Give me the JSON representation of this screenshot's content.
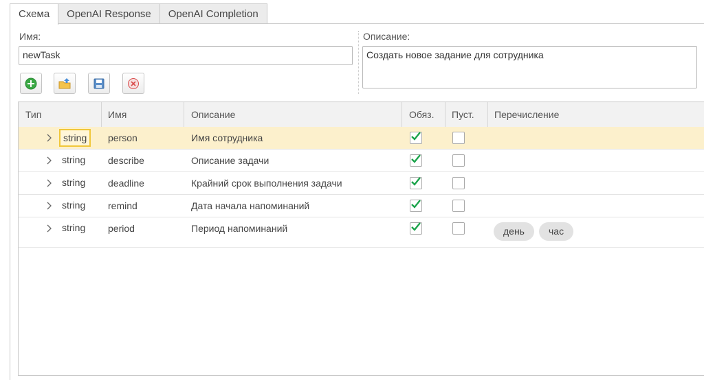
{
  "tabs": [
    "Схема",
    "OpenAI Response",
    "OpenAI Completion"
  ],
  "form": {
    "name_label": "Имя:",
    "name_value": "newTask",
    "description_label": "Описание:",
    "description_value": "Создать новое задание для сотрудника"
  },
  "toolbar": {
    "buttons": [
      "add-icon",
      "folder-upload-icon",
      "save-icon",
      "delete-icon"
    ]
  },
  "table": {
    "headers": [
      "Тип",
      "Имя",
      "Описание",
      "Обяз.",
      "Пуст.",
      "Перечисление"
    ],
    "rows": [
      {
        "type": "string",
        "name": "person",
        "description": "Имя сотрудника",
        "required": true,
        "empty": false,
        "enum": []
      },
      {
        "type": "string",
        "name": "describe",
        "description": "Описание задачи",
        "required": true,
        "empty": false,
        "enum": []
      },
      {
        "type": "string",
        "name": "deadline",
        "description": "Крайний срок выполнения задачи",
        "required": true,
        "empty": false,
        "enum": []
      },
      {
        "type": "string",
        "name": "remind",
        "description": "Дата начала напоминаний",
        "required": true,
        "empty": false,
        "enum": []
      },
      {
        "type": "string",
        "name": "period",
        "description": "Период напоминаний",
        "required": true,
        "empty": false,
        "enum": [
          "день",
          "час"
        ]
      }
    ]
  },
  "colors": {
    "selected_row": "#fcf0cc",
    "focus_border": "#f0c73a",
    "check_green": "#1aa34a",
    "add_green": "#3aa844",
    "delete_red": "#d94a4a"
  }
}
